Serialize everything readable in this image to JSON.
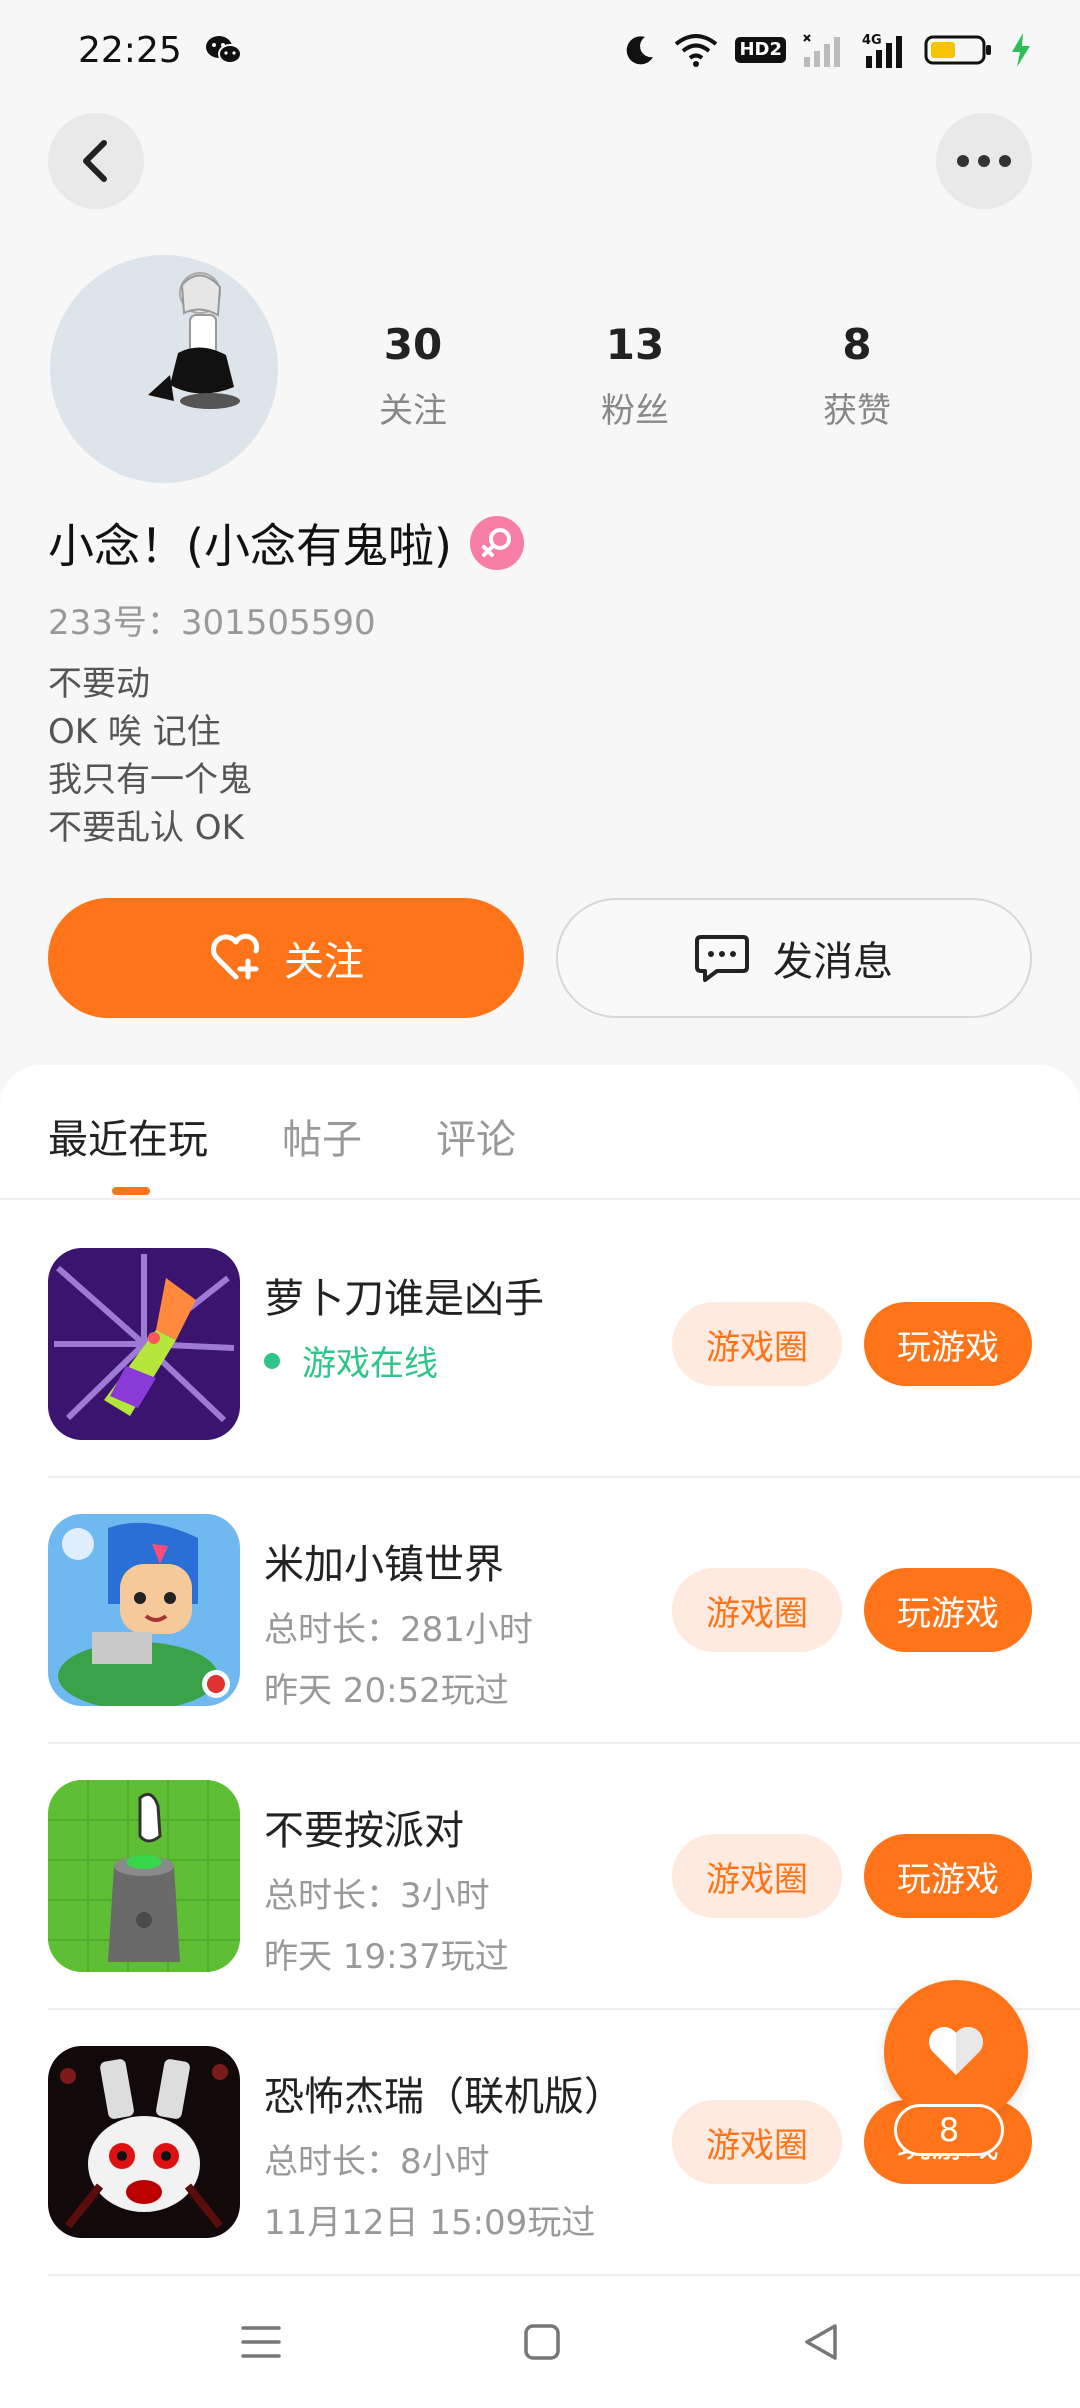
{
  "status_bar": {
    "time": "22:25",
    "icons": [
      "wechat-icon",
      "moon-icon",
      "wifi-icon",
      "hd-icon",
      "signal-icon",
      "4g-signal-icon",
      "battery-icon",
      "charging-icon"
    ],
    "hd_label": "HD2",
    "network_label": "4G"
  },
  "header": {
    "back_icon": "chevron-left-icon",
    "more_icon": "more-dots-icon"
  },
  "profile": {
    "stats": [
      {
        "value": "30",
        "label": "关注"
      },
      {
        "value": "13",
        "label": "粉丝"
      },
      {
        "value": "8",
        "label": "获赞"
      }
    ],
    "name": "小念！(小念有鬼啦)",
    "gender_icon": "female-icon",
    "id_text": "233号：301505590",
    "bio": [
      "不要动",
      "OK 唉 记住",
      "我只有一个鬼",
      "不要乱认 OK"
    ]
  },
  "actions": {
    "follow_label": "关注",
    "message_label": "发消息"
  },
  "tabs": [
    {
      "label": "最近在玩",
      "active": true
    },
    {
      "label": "帖子",
      "active": false
    },
    {
      "label": "评论",
      "active": false
    }
  ],
  "games": [
    {
      "title": "萝卜刀谁是凶手",
      "online": "游戏在线",
      "circle_label": "游戏圈",
      "play_label": "玩游戏"
    },
    {
      "title": "米加小镇世界",
      "duration": "总时长：281小时",
      "last_played": "昨天 20:52玩过",
      "circle_label": "游戏圈",
      "play_label": "玩游戏"
    },
    {
      "title": "不要按派对",
      "duration": "总时长：3小时",
      "last_played": "昨天 19:37玩过",
      "circle_label": "游戏圈",
      "play_label": "玩游戏"
    },
    {
      "title": "恐怖杰瑞（联机版）",
      "duration": "总时长：8小时",
      "last_played": "11月12日 15:09玩过",
      "circle_label": "游戏圈",
      "play_label": "玩游戏"
    }
  ],
  "fab": {
    "icon": "heart-icon",
    "count": "8"
  },
  "colors": {
    "accent": "#ff7419",
    "accent_light": "#ffeadf",
    "online": "#2fc48b",
    "female_badge": "#f77fa6"
  }
}
